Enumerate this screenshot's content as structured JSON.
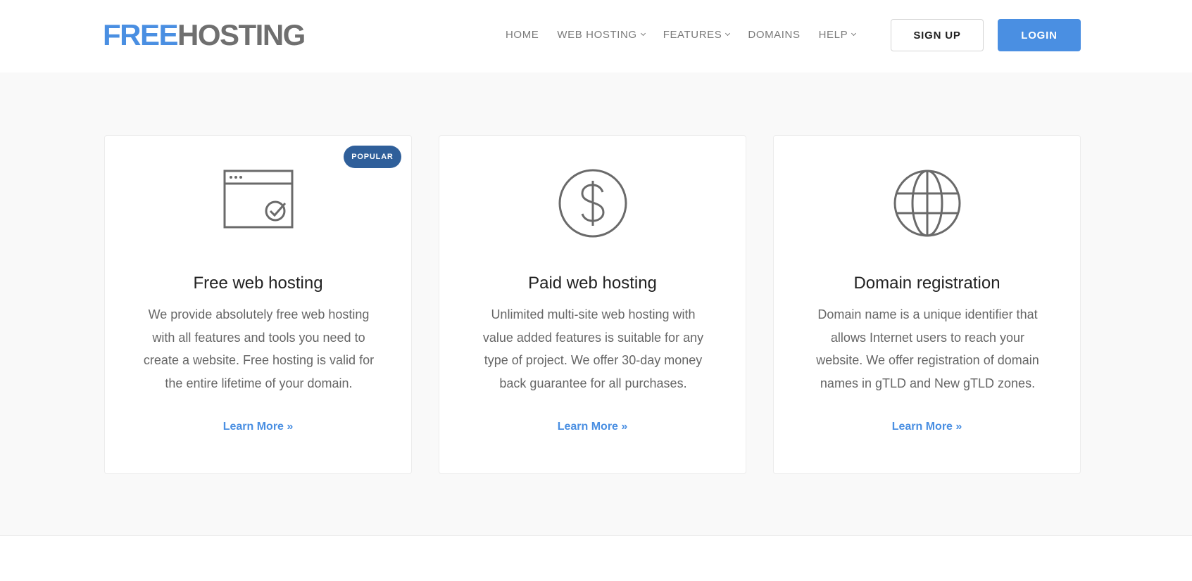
{
  "header": {
    "logo": {
      "part1": "FREE",
      "part2": "HOSTING"
    },
    "nav": [
      {
        "label": "HOME"
      },
      {
        "label": "WEB HOSTING"
      },
      {
        "label": "FEATURES"
      },
      {
        "label": "DOMAINS"
      },
      {
        "label": "HELP"
      }
    ],
    "signup_label": "SIGN UP",
    "login_label": "LOGIN"
  },
  "cards": [
    {
      "icon": "browser-window-check-icon",
      "badge": "POPULAR",
      "title": "Free web hosting",
      "description": "We provide absolutely free web hosting with all features and tools you need to create a website. Free hosting is valid for the entire lifetime of your domain.",
      "link": "Learn More »"
    },
    {
      "icon": "dollar-circle-icon",
      "title": "Paid web hosting",
      "description": "Unlimited multi-site web hosting with value added features is suitable for any type of project. We offer 30-day money back guarantee for all purchases.",
      "link": "Learn More »"
    },
    {
      "icon": "globe-icon",
      "title": "Domain registration",
      "description": "Domain name is a unique identifier that allows Internet users to reach your website. We offer registration of domain names in gTLD and New gTLD zones.",
      "link": "Learn More »"
    }
  ],
  "colors": {
    "brand_blue": "#4a8fe2",
    "badge_blue": "#2f5f9a",
    "logo_gray": "#6f6f6f"
  }
}
